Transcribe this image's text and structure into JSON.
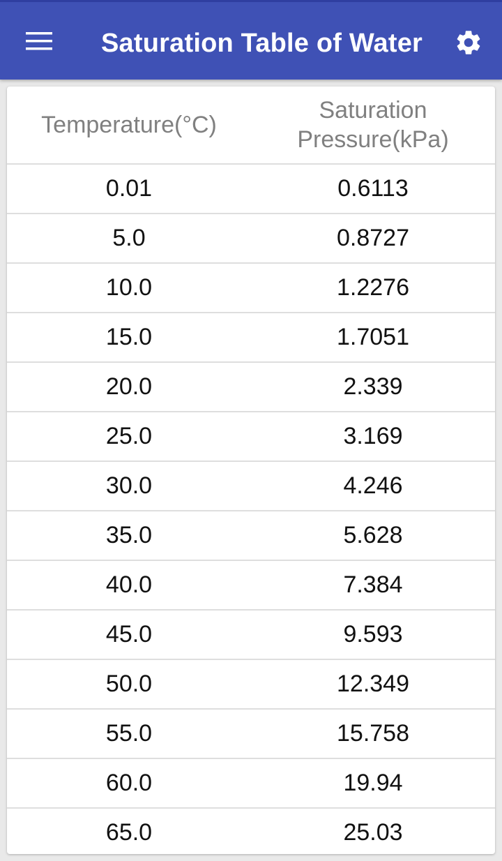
{
  "app_bar": {
    "title": "Saturation Table of Water",
    "menu_icon": "hamburger-menu-icon",
    "settings_icon": "gear-icon",
    "color": "#3f51b5"
  },
  "table": {
    "headers": {
      "temperature": "Temperature(°C)",
      "pressure_line1": "Saturation",
      "pressure_line2": "Pressure(kPa)"
    },
    "rows": [
      {
        "temperature": "0.01",
        "pressure": "0.6113"
      },
      {
        "temperature": "5.0",
        "pressure": "0.8727"
      },
      {
        "temperature": "10.0",
        "pressure": "1.2276"
      },
      {
        "temperature": "15.0",
        "pressure": "1.7051"
      },
      {
        "temperature": "20.0",
        "pressure": "2.339"
      },
      {
        "temperature": "25.0",
        "pressure": "3.169"
      },
      {
        "temperature": "30.0",
        "pressure": "4.246"
      },
      {
        "temperature": "35.0",
        "pressure": "5.628"
      },
      {
        "temperature": "40.0",
        "pressure": "7.384"
      },
      {
        "temperature": "45.0",
        "pressure": "9.593"
      },
      {
        "temperature": "50.0",
        "pressure": "12.349"
      },
      {
        "temperature": "55.0",
        "pressure": "15.758"
      },
      {
        "temperature": "60.0",
        "pressure": "19.94"
      },
      {
        "temperature": "65.0",
        "pressure": "25.03"
      }
    ]
  }
}
